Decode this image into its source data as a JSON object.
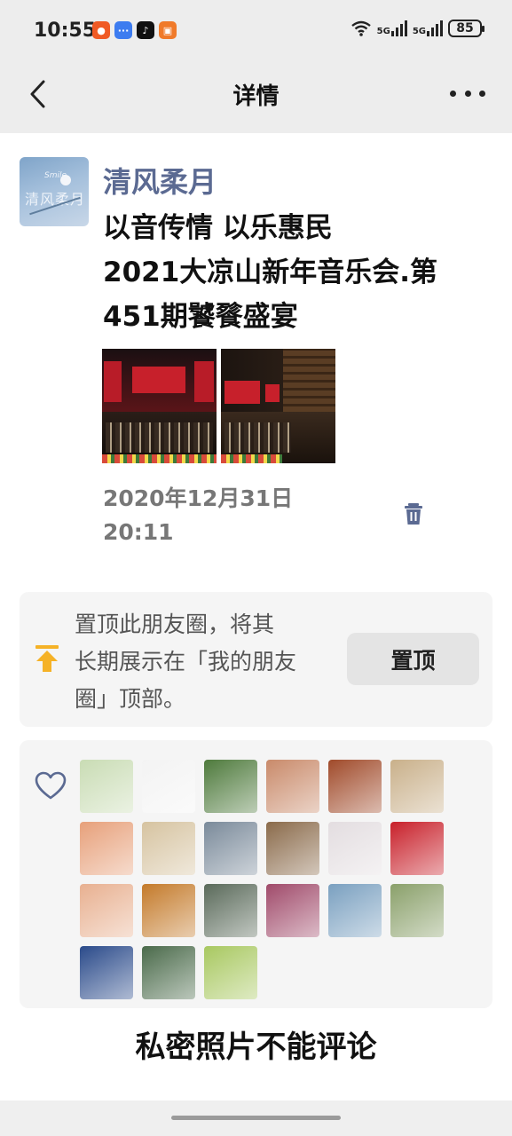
{
  "status_bar": {
    "time": "10:55",
    "apps": [
      {
        "icon": "app-icon-red-orange",
        "color": "#f05a24"
      },
      {
        "icon": "message-app-icon",
        "color": "#3d7cf0"
      },
      {
        "icon": "tiktok-icon",
        "color": "#111111"
      },
      {
        "icon": "app-icon-orange",
        "color": "#f07a2a"
      }
    ],
    "network_1": "5G",
    "network_2": "5G",
    "battery": "85"
  },
  "header": {
    "title": "详情"
  },
  "post": {
    "username": "清风柔月",
    "avatar_text": "清风柔月",
    "avatar_small": "Smile",
    "text_line1": "以音传情 以乐惠民",
    "text_line2": "2021大凉山新年音乐会.第",
    "text_line3": "451期饕餮盛宴",
    "date_line1": "2020年12月31日",
    "date_line2": "20:11"
  },
  "pin": {
    "line1": "置顶此朋友圈，将其",
    "line2": "长期展示在「我的朋友",
    "line3": "圈」顶部。",
    "button": "置顶",
    "accent": "#f5b227"
  },
  "likes": {
    "accent": "#5b6a92",
    "avatars": [
      "#c9dcb4",
      "#f3f3f3",
      "#4e7a3c",
      "#c98a6a",
      "#a04a2a",
      "#c9b08a",
      "#e7a07a",
      "#d6c3a0",
      "#7a8a9a",
      "#8a6a4a",
      "#e3dde0",
      "#c8202a",
      "#e8b090",
      "#c47a2a",
      "#5a6a5a",
      "#a04a6a",
      "#7aa0c0",
      "#8aa06a",
      "#2a4a8a",
      "#4a6a4a",
      "#a8c860"
    ]
  },
  "footer": {
    "no_comment": "私密照片不能评论"
  }
}
